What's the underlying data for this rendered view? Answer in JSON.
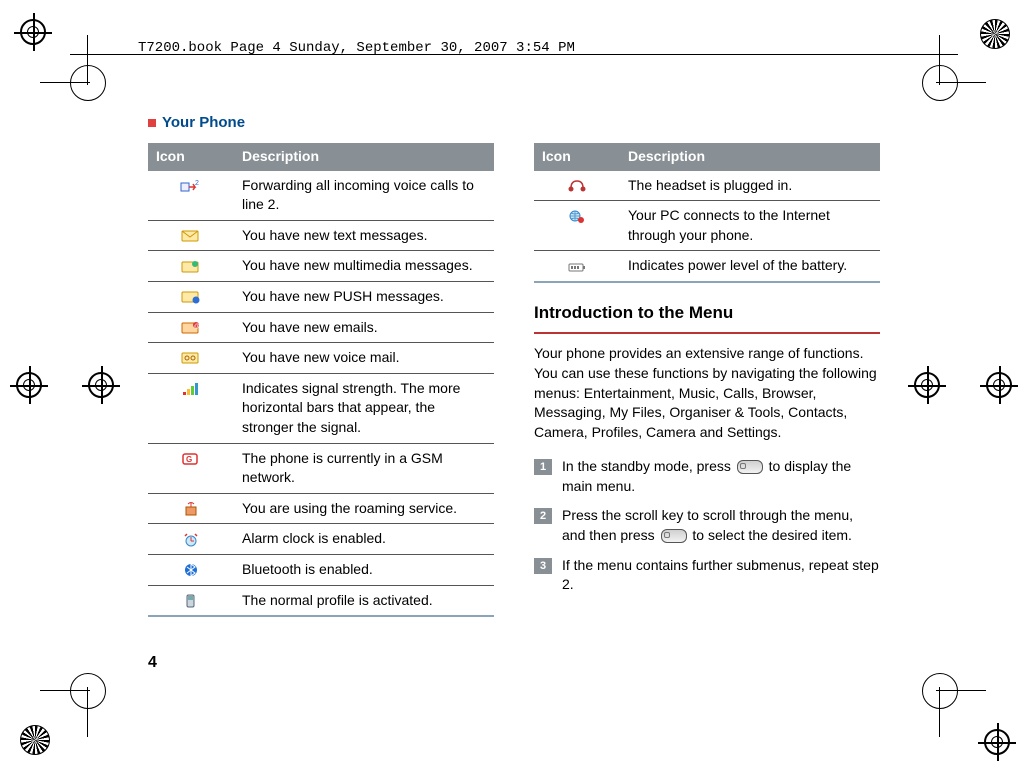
{
  "header_bar": "T7200.book  Page 4  Sunday, September 30, 2007  3:54 PM",
  "section_title": "Your Phone",
  "table_headers": {
    "icon": "Icon",
    "desc": "Description"
  },
  "left_rows": [
    {
      "icon": "forward-line2-icon",
      "desc": "Forwarding all incoming voice calls to line 2."
    },
    {
      "icon": "new-text-icon",
      "desc": "You have new text messages."
    },
    {
      "icon": "new-mms-icon",
      "desc": "You have new multimedia messages."
    },
    {
      "icon": "new-push-icon",
      "desc": "You have new PUSH messages."
    },
    {
      "icon": "new-email-icon",
      "desc": "You have new emails."
    },
    {
      "icon": "new-voicemail-icon",
      "desc": "You have new voice mail."
    },
    {
      "icon": "signal-strength-icon",
      "desc": "Indicates signal strength. The more horizontal bars that appear, the stronger the signal."
    },
    {
      "icon": "gsm-network-icon",
      "desc": "The phone is currently in a GSM network."
    },
    {
      "icon": "roaming-icon",
      "desc": "You are using the roaming service."
    },
    {
      "icon": "alarm-enabled-icon",
      "desc": "Alarm clock is enabled."
    },
    {
      "icon": "bluetooth-enabled-icon",
      "desc": "Bluetooth is enabled."
    },
    {
      "icon": "normal-profile-icon",
      "desc": "The normal profile is activated."
    }
  ],
  "right_rows": [
    {
      "icon": "headset-plugged-icon",
      "desc": "The headset is plugged in."
    },
    {
      "icon": "pc-internet-icon",
      "desc": "Your PC connects to the Internet through your phone."
    },
    {
      "icon": "battery-level-icon",
      "desc": "Indicates power level of the battery."
    }
  ],
  "h2": "Introduction to the Menu",
  "intro_para": "Your phone provides an extensive range of functions. You can use these functions by navigating the following menus: Entertainment, Music, Calls, Browser, Messaging, My Files, Organiser & Tools, Contacts, Camera, Profiles, Camera and Settings.",
  "steps": [
    {
      "n": "1",
      "before": "In the standby mode, press ",
      "after": " to display the main menu."
    },
    {
      "n": "2",
      "before": "Press the scroll key to scroll through the menu, and then press ",
      "after": " to select the desired item."
    },
    {
      "n": "3",
      "before": "If the menu contains further submenus, repeat step 2.",
      "after": ""
    }
  ],
  "page_number": "4"
}
